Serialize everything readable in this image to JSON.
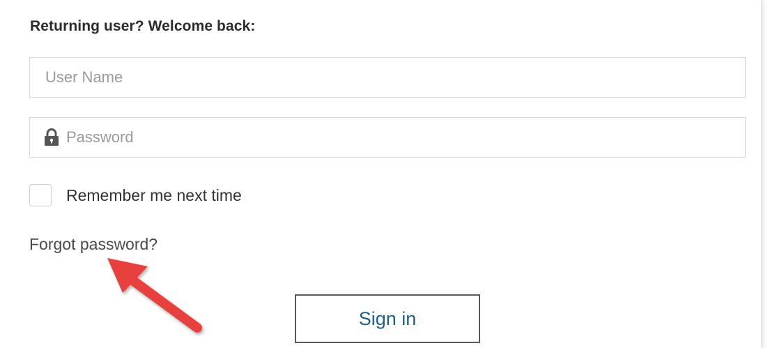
{
  "form": {
    "heading": "Returning user? Welcome back:",
    "username": {
      "placeholder": "User Name",
      "value": ""
    },
    "password": {
      "icon": "lock-icon",
      "placeholder": "Password",
      "value": ""
    },
    "remember_me": {
      "label": "Remember me next time",
      "checked": false
    },
    "forgot_password_label": "Forgot password?",
    "sign_in_label": "Sign in"
  },
  "annotation": {
    "icon": "arrow-icon",
    "color": "#e8403c"
  },
  "colors": {
    "button_text": "#1f5f8b",
    "button_border": "#5a5a5a",
    "field_border": "#d6d6d6"
  }
}
